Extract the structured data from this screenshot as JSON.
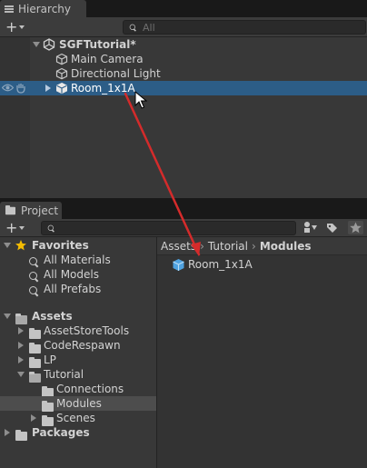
{
  "hierarchy": {
    "tab_label": "Hierarchy",
    "search_placeholder": "All",
    "scene_name": "SGFTutorial*",
    "items": [
      {
        "label": "Main Camera"
      },
      {
        "label": "Directional Light"
      },
      {
        "label": "Room_1x1A",
        "selected": true
      }
    ]
  },
  "project": {
    "tab_label": "Project",
    "favorites_label": "Favorites",
    "favorites": [
      "All Materials",
      "All Models",
      "All Prefabs"
    ],
    "assets_label": "Assets",
    "asset_folders": [
      "AssetStoreTools",
      "CodeRespawn",
      "LP",
      "Tutorial"
    ],
    "tutorial_subfolders": [
      "Connections",
      "Modules",
      "Scenes"
    ],
    "packages_label": "Packages",
    "breadcrumb": [
      "Assets",
      "Tutorial",
      "Modules"
    ],
    "files": [
      "Room_1x1A"
    ]
  },
  "colors": {
    "selection": "#2c5d87",
    "drag_arrow": "#d42b2b",
    "favorite_star": "#f4bc02",
    "prefab_blue": "#4fa2e0"
  }
}
